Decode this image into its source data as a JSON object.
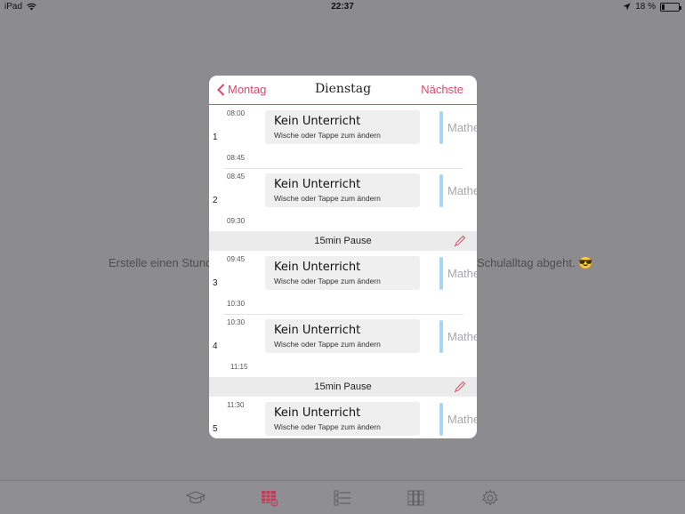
{
  "status": {
    "device": "iPad",
    "time": "22:37",
    "battery": "18 %",
    "battery_level": 0.18
  },
  "background_text": {
    "left": "Erstelle einen Stunden",
    "right": "Schulalltag abgeht. 😎"
  },
  "modal": {
    "back_label": "Montag",
    "title": "Dienstag",
    "next_label": "Nächste",
    "lessons": [
      {
        "number": "1",
        "start": "08:00",
        "end": "08:45",
        "title": "Kein Unterricht",
        "subtitle": "Wische oder Tappe zum ändern",
        "subject": "Mathe"
      },
      {
        "number": "2",
        "start": "08:45",
        "end": "09:30",
        "title": "Kein Unterricht",
        "subtitle": "Wische oder Tappe zum ändern",
        "subject": "Mathe"
      },
      {
        "number": "3",
        "start": "09:45",
        "end": "10:30",
        "title": "Kein Unterricht",
        "subtitle": "Wische oder Tappe zum ändern",
        "subject": "Mathe"
      },
      {
        "number": "4",
        "start": "10:30",
        "end": "11:15",
        "title": "Kein Unterricht",
        "subtitle": "Wische oder Tappe zum ändern",
        "subject": "Mathe"
      },
      {
        "number": "5",
        "start": "11:30",
        "end": "",
        "title": "Kein Unterricht",
        "subtitle": "Wische oder Tappe zum ändern",
        "subject": "Mathe"
      }
    ],
    "pauses": [
      {
        "label": "15min Pause"
      },
      {
        "label": "15min Pause"
      }
    ]
  },
  "tabbar": {
    "icons": [
      "graduation-cap-icon",
      "timetable-icon",
      "checklist-icon",
      "books-icon",
      "settings-gear-icon"
    ],
    "active": 1
  },
  "colors": {
    "accent": "#e0466a",
    "subject_bar": "#a8d6f2",
    "background": "#8c8c8f"
  }
}
